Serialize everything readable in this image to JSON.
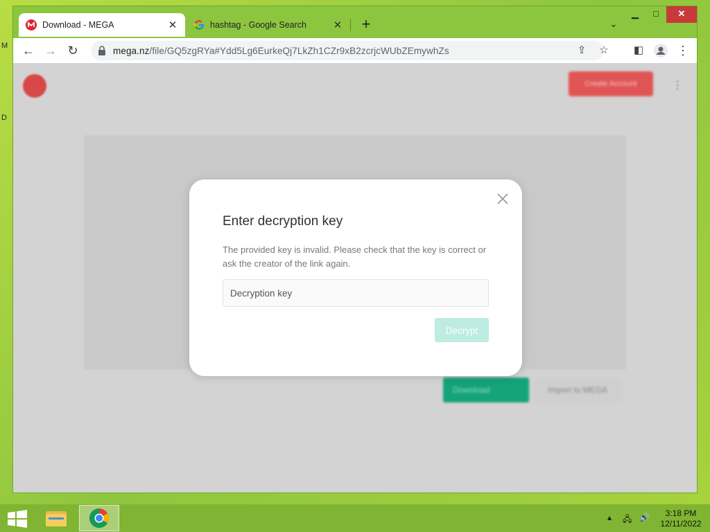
{
  "desktop": {
    "glyph_top": "M",
    "glyph_mid": "D"
  },
  "browser": {
    "tabs": [
      {
        "title": "Download - MEGA",
        "favicon": "mega-logo-icon",
        "active": true
      },
      {
        "title": "hashtag - Google Search",
        "favicon": "google-logo-icon",
        "active": false
      }
    ],
    "url_host": "mega.nz",
    "url_path": "/file/GQ5zgRYa#Ydd5Lg6EurkeQj7LkZh1CZr9xB2zcrjcWUbZEmywhZs"
  },
  "page_background": {
    "create_account_label": "Create Account",
    "download_label": "Download",
    "import_label": "Import to MEGA"
  },
  "dialog": {
    "title": "Enter decryption key",
    "message": "The provided key is invalid. Please check that the key is correct or ask the creator of the link again.",
    "input_placeholder": "Decryption key",
    "input_value": "",
    "button_label": "Decrypt"
  },
  "taskbar": {
    "time": "3:18 PM",
    "date": "12/11/2022"
  },
  "colors": {
    "mega_red": "#d93a3a",
    "decrypt_button_disabled": "#bdece0",
    "desktop_green": "#8ec63f"
  }
}
